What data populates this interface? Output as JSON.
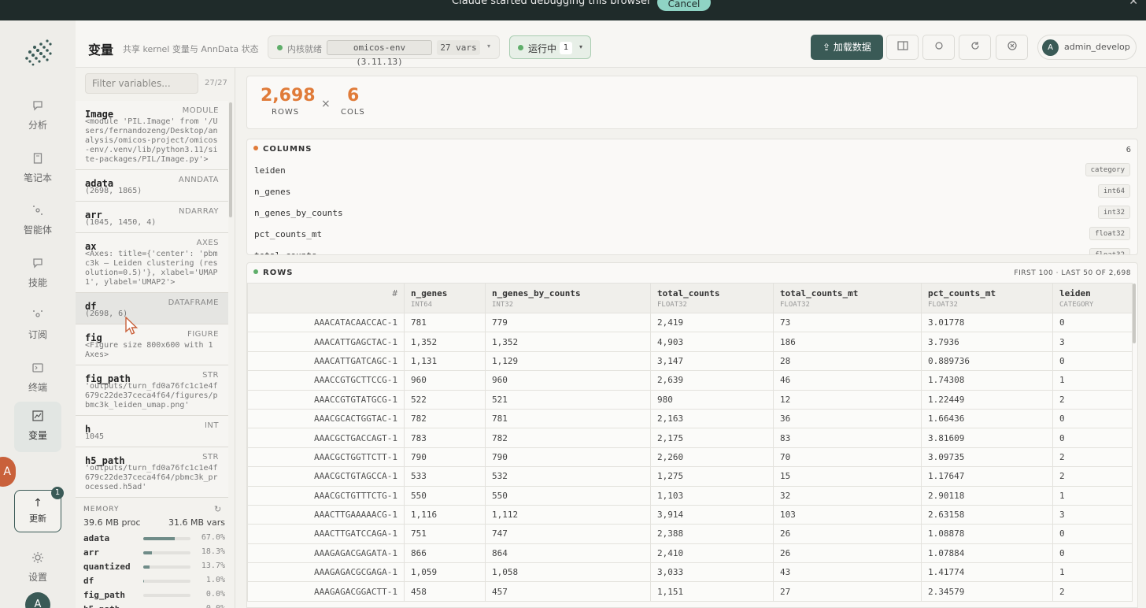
{
  "banner": {
    "text": "Claude  started debugging this browser",
    "cancel_label": "Cancel",
    "close": "✕"
  },
  "rail": {
    "items": [
      {
        "label": "分析",
        "icon": "chat-icon"
      },
      {
        "label": "笔记本",
        "icon": "notebook-icon"
      },
      {
        "label": "智能体",
        "icon": "agent-icon"
      },
      {
        "label": "技能",
        "icon": "skill-icon"
      },
      {
        "label": "订阅",
        "icon": "subscribe-icon"
      },
      {
        "label": "终端",
        "icon": "terminal-icon"
      },
      {
        "label": "变量",
        "icon": "chart-icon"
      }
    ],
    "update_label": "更新",
    "update_badge": "1",
    "translate": "A",
    "settings_label": "设置",
    "avatar": "A"
  },
  "header": {
    "title": "变量",
    "subtitle": "共享 kernel 变量与 AnnData 状态",
    "kernel_status": "内核就绪",
    "env": "omicos-env (3.11.13)",
    "vars_count": "27 vars",
    "running_label": "运行中",
    "running_count": "1",
    "load_label": "加载数据",
    "user_avatar": "A",
    "user_name": "admin_develop"
  },
  "vars_panel": {
    "filter_placeholder": "Filter variables...",
    "filter_count": "27/27",
    "items": [
      {
        "name": "Image",
        "type": "MODULE",
        "desc": "<module 'PIL.Image' from '/Users/fernandozeng/Desktop/analysis/omicos-project/omicos-env/.venv/lib/python3.11/site-packages/PIL/Image.py'>"
      },
      {
        "name": "adata",
        "type": "ANNDATA",
        "desc": "(2698, 1865)"
      },
      {
        "name": "arr",
        "type": "NDARRAY",
        "desc": "(1045, 1450, 4)"
      },
      {
        "name": "ax",
        "type": "AXES",
        "desc": "<Axes: title={'center': 'pbmc3k — Leiden clustering (resolution=0.5)'}, xlabel='UMAP1', ylabel='UMAP2'>"
      },
      {
        "name": "df",
        "type": "DATAFRAME",
        "desc": "(2698, 6)"
      },
      {
        "name": "fig",
        "type": "FIGURE",
        "desc": "<Figure size 800x600 with 1 Axes>"
      },
      {
        "name": "fig_path",
        "type": "STR",
        "desc": "'outputs/turn_fd0a76fc1c1e4f679c22de37ceca4f64/figures/pbmc3k_leiden_umap.png'"
      },
      {
        "name": "h",
        "type": "INT",
        "desc": "1045"
      },
      {
        "name": "h5_path",
        "type": "STR",
        "desc": "'outputs/turn_fd0a76fc1c1e4f679c22de37ceca4f64/pbmc3k_processed.h5ad'"
      }
    ],
    "memory": {
      "title": "MEMORY",
      "proc": "39.6 MB proc",
      "vars": "31.6 MB vars",
      "rows": [
        {
          "name": "adata",
          "pct": "67.0%",
          "frac": 0.67
        },
        {
          "name": "arr",
          "pct": "18.3%",
          "frac": 0.183
        },
        {
          "name": "quantized",
          "pct": "13.7%",
          "frac": 0.137
        },
        {
          "name": "df",
          "pct": "1.0%",
          "frac": 0.01
        },
        {
          "name": "fig_path",
          "pct": "0.0%",
          "frac": 0.0
        },
        {
          "name": "h5_path",
          "pct": "0.0%",
          "frac": 0.0
        }
      ]
    }
  },
  "summary": {
    "rows": "2,698",
    "rows_label": "ROWS",
    "times": "×",
    "cols": "6",
    "cols_label": "COLS"
  },
  "columns": {
    "title": "COLUMNS",
    "count": "6",
    "items": [
      {
        "name": "leiden",
        "type": "category"
      },
      {
        "name": "n_genes",
        "type": "int64"
      },
      {
        "name": "n_genes_by_counts",
        "type": "int32"
      },
      {
        "name": "pct_counts_mt",
        "type": "float32"
      },
      {
        "name": "total_counts",
        "type": "float32"
      }
    ]
  },
  "rows_table": {
    "title": "ROWS",
    "info": "FIRST 100 · LAST 50 OF 2,698",
    "index_header": "#",
    "headers": [
      {
        "name": "n_genes",
        "type": "INT64"
      },
      {
        "name": "n_genes_by_counts",
        "type": "INT32"
      },
      {
        "name": "total_counts",
        "type": "FLOAT32"
      },
      {
        "name": "total_counts_mt",
        "type": "FLOAT32"
      },
      {
        "name": "pct_counts_mt",
        "type": "FLOAT32"
      },
      {
        "name": "leiden",
        "type": "CATEGORY"
      }
    ],
    "rows": [
      [
        "AAACATACAACCAC-1",
        "781",
        "779",
        "2,419",
        "73",
        "3.01778",
        "0"
      ],
      [
        "AAACATTGAGCTAC-1",
        "1,352",
        "1,352",
        "4,903",
        "186",
        "3.7936",
        "3"
      ],
      [
        "AAACATTGATCAGC-1",
        "1,131",
        "1,129",
        "3,147",
        "28",
        "0.889736",
        "0"
      ],
      [
        "AAACCGTGCTTCCG-1",
        "960",
        "960",
        "2,639",
        "46",
        "1.74308",
        "1"
      ],
      [
        "AAACCGTGTATGCG-1",
        "522",
        "521",
        "980",
        "12",
        "1.22449",
        "2"
      ],
      [
        "AAACGCACTGGTAC-1",
        "782",
        "781",
        "2,163",
        "36",
        "1.66436",
        "0"
      ],
      [
        "AAACGCTGACCAGT-1",
        "783",
        "782",
        "2,175",
        "83",
        "3.81609",
        "0"
      ],
      [
        "AAACGCTGGTTCTT-1",
        "790",
        "790",
        "2,260",
        "70",
        "3.09735",
        "2"
      ],
      [
        "AAACGCTGTAGCCA-1",
        "533",
        "532",
        "1,275",
        "15",
        "1.17647",
        "2"
      ],
      [
        "AAACGCTGTTTCTG-1",
        "550",
        "550",
        "1,103",
        "32",
        "2.90118",
        "1"
      ],
      [
        "AAACTTGAAAAACG-1",
        "1,116",
        "1,112",
        "3,914",
        "103",
        "2.63158",
        "3"
      ],
      [
        "AAACTTGATCCAGA-1",
        "751",
        "747",
        "2,388",
        "26",
        "1.08878",
        "0"
      ],
      [
        "AAAGAGACGAGATA-1",
        "866",
        "864",
        "2,410",
        "26",
        "1.07884",
        "0"
      ],
      [
        "AAAGAGACGCGAGA-1",
        "1,059",
        "1,058",
        "3,033",
        "43",
        "1.41774",
        "1"
      ],
      [
        "AAAGAGACGGACTT-1",
        "458",
        "457",
        "1,151",
        "27",
        "2.34579",
        "2"
      ]
    ]
  }
}
